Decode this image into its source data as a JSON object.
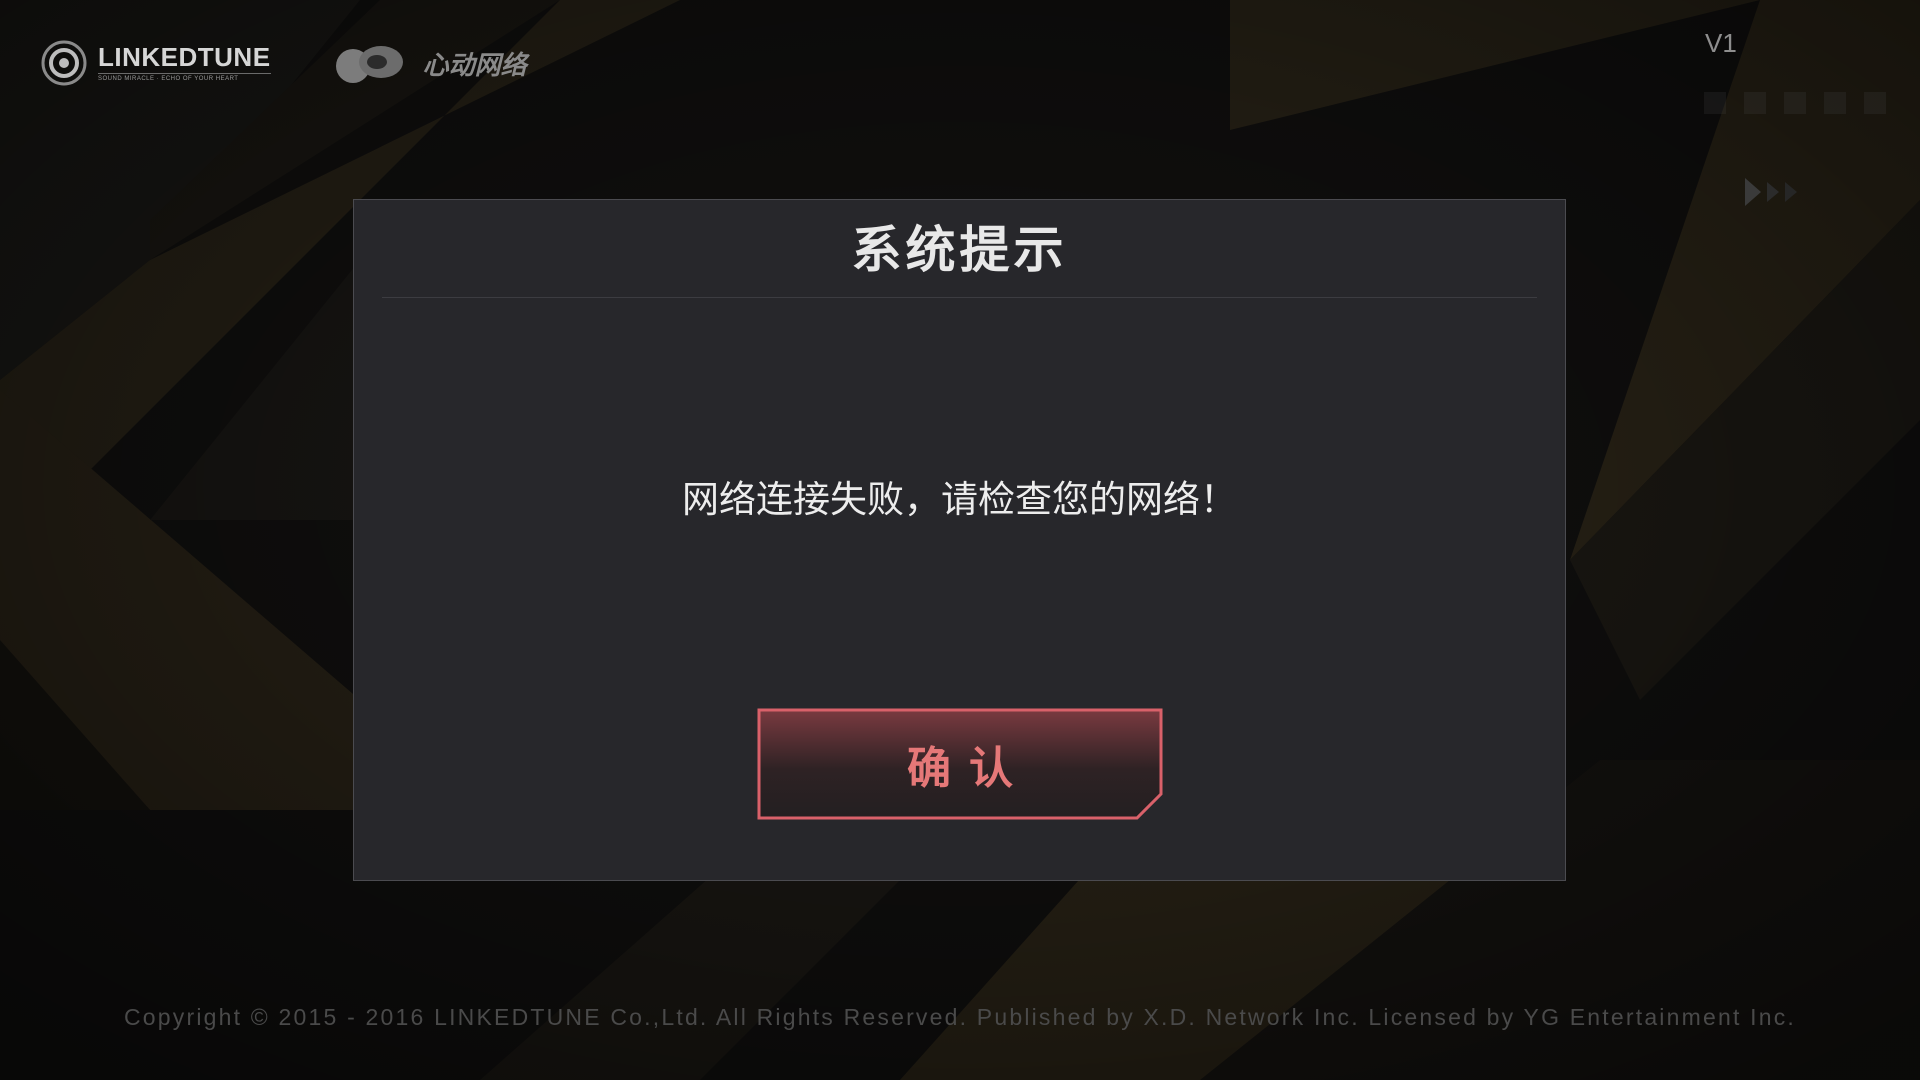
{
  "header": {
    "brand_linkedtune": "LINKEDTUNE",
    "brand_linkedtune_tagline": "SOUND MIRACLE · ECHO OF YOUR HEART",
    "brand_xd": "心动网络",
    "version": "V1"
  },
  "dialog": {
    "title": "系统提示",
    "message": "网络连接失败，请检查您的网络！",
    "confirm_label": "确认"
  },
  "footer": {
    "copyright": "Copyright © 2015 - 2016 LINKEDTUNE Co.,Ltd. All Rights Reserved. Published by X.D. Network Inc. Licensed by YG Entertainment Inc."
  },
  "colors": {
    "dialog_bg": "#27272b",
    "button_border": "#d9616a",
    "button_text": "#e57878",
    "background_gold": "#3a2f1c"
  }
}
